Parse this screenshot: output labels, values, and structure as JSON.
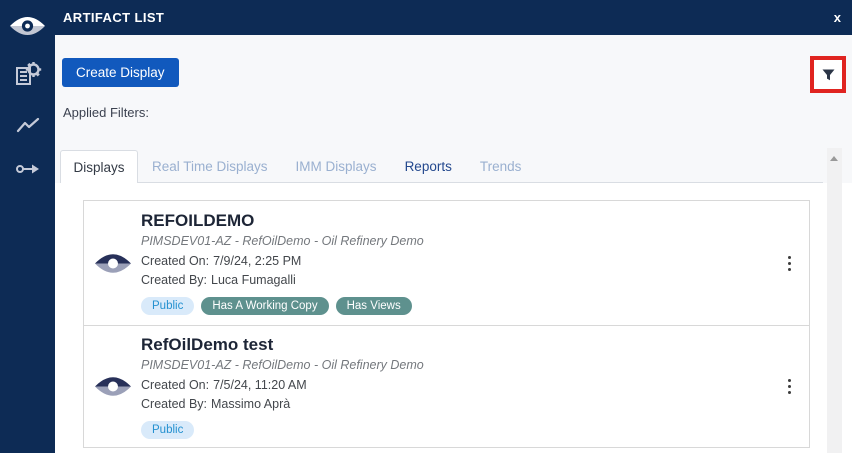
{
  "header": {
    "title": "ARTIFACT LIST",
    "close_label": "x"
  },
  "sidebar": {
    "icons": [
      "app-logo-eye",
      "artifact-list",
      "trends",
      "output"
    ]
  },
  "toolbar": {
    "create_button_label": "Create Display",
    "filter_icon": "funnel-icon",
    "filter_highlight_color": "#e02420"
  },
  "filters": {
    "applied_label": "Applied Filters:"
  },
  "tabs": [
    {
      "label": "Displays",
      "state": "active"
    },
    {
      "label": "Real Time Displays",
      "state": "inactive"
    },
    {
      "label": "IMM Displays",
      "state": "inactive"
    },
    {
      "label": "Reports",
      "state": "emphasized"
    },
    {
      "label": "Trends",
      "state": "inactive"
    }
  ],
  "artifacts": [
    {
      "title": "REFOILDEMO",
      "source": "PIMSDEV01-AZ - RefOilDemo - Oil Refinery Demo",
      "created_on_label": "Created On:",
      "created_on": "7/9/24, 2:25 PM",
      "created_by_label": "Created By:",
      "created_by": "Luca Fumagalli",
      "badges": [
        {
          "label": "Public",
          "type": "public"
        },
        {
          "label": "Has A Working Copy",
          "type": "teal"
        },
        {
          "label": "Has Views",
          "type": "teal"
        }
      ]
    },
    {
      "title": "RefOilDemo test",
      "source": "PIMSDEV01-AZ - RefOilDemo - Oil Refinery Demo",
      "created_on_label": "Created On:",
      "created_on": "7/5/24, 11:20 AM",
      "created_by_label": "Created By:",
      "created_by": "Massimo Aprà",
      "badges": [
        {
          "label": "Public",
          "type": "public"
        }
      ]
    }
  ],
  "colors": {
    "navy": "#0d2b55",
    "button_blue": "#1159bd",
    "badge_public_bg": "#d9eafa",
    "badge_public_text": "#2491d0",
    "badge_teal_bg": "#5e918e",
    "tab_inactive": "#9ab0d0",
    "tab_emphasized": "#24498e",
    "page_bg": "#f7f8fa"
  }
}
